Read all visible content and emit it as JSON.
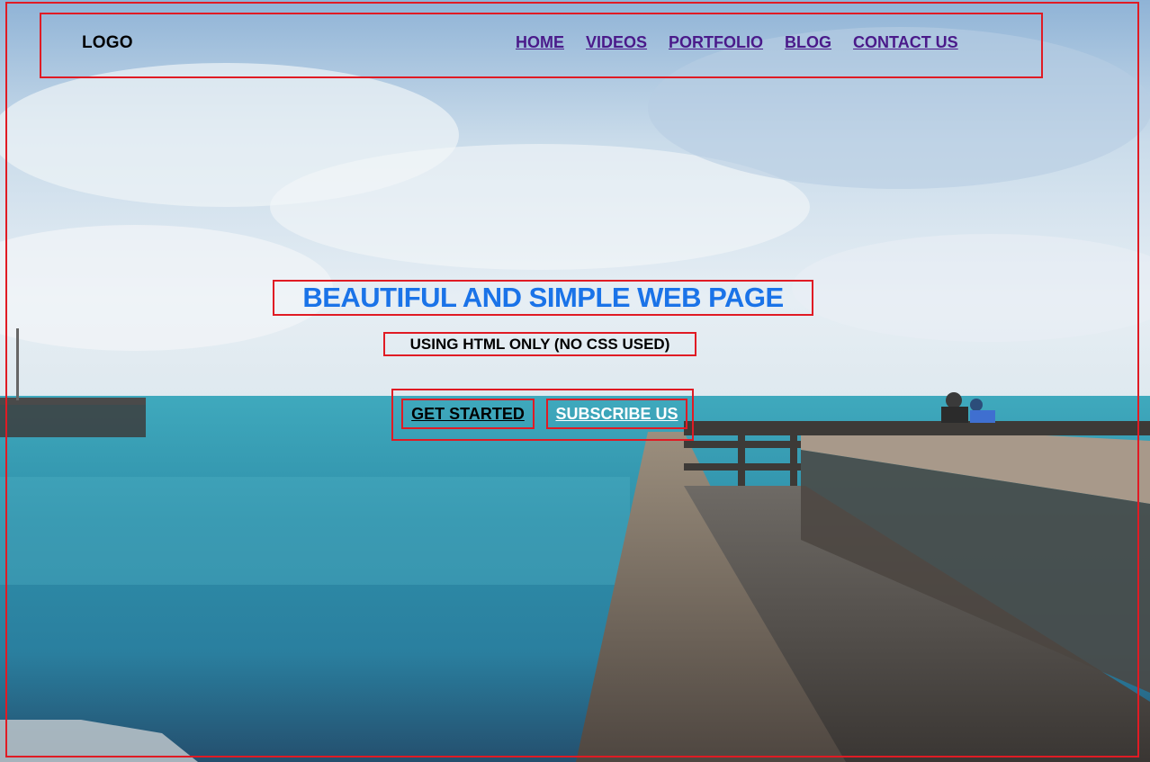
{
  "header": {
    "logo": "LOGO",
    "nav": [
      "HOME",
      "VIDEOS",
      "PORTFOLIO",
      "BLOG",
      "CONTACT US"
    ]
  },
  "hero": {
    "title": "BEAUTIFUL AND SIMPLE WEB PAGE",
    "subtitle": "USING HTML ONLY (NO CSS USED)",
    "buttons": {
      "start": "GET STARTED",
      "subscribe": "SUBSCRIBE US"
    }
  },
  "colors": {
    "annotation_border": "#e01b24",
    "title": "#1a73e8",
    "nav_link": "#4a1a8a"
  },
  "background": {
    "icon": "sea-pier-photo"
  }
}
